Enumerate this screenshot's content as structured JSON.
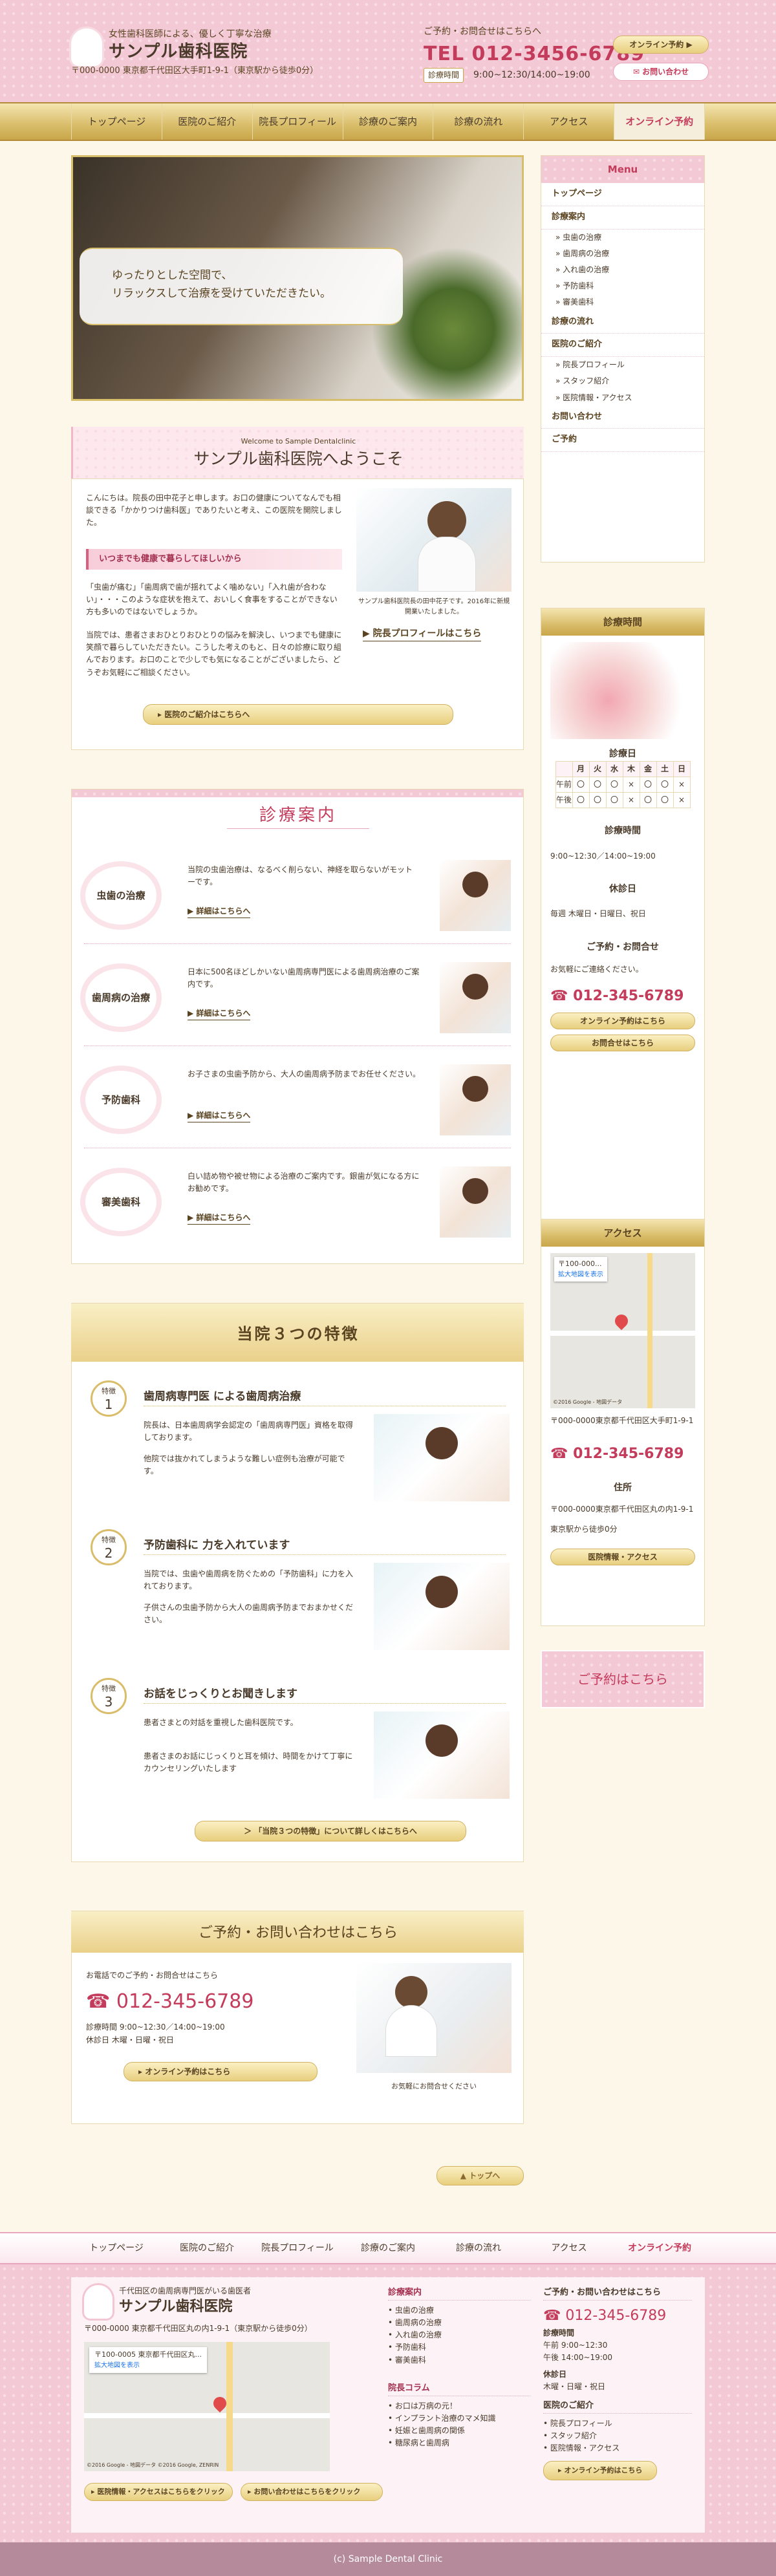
{
  "header": {
    "tagline": "女性歯科医師による、優しく丁寧な治療",
    "site_name": "サンプル歯科医院",
    "address": "〒000-0000 東京都千代田区大手町1-9-1（東京駅から徒歩0分）",
    "contact_label": "ご予約・お問合せはこちらへ",
    "tel": "TEL 012-3456-6789",
    "hours_label": "診療時間",
    "hours": "9:00~12:30/14:00~19:00",
    "btn_online": "オンライン予約 ▶",
    "btn_contact": "✉ お問い合わせ"
  },
  "nav": [
    "トップページ",
    "医院のご紹介",
    "院長プロフィール",
    "診療のご案内",
    "診療の流れ",
    "アクセス",
    "オンライン予約"
  ],
  "hero": {
    "line1": "ゆったりとした空間で、",
    "line2": "リラックスして治療を受けていただきたい。"
  },
  "welcome": {
    "sub": "Welcome to Sample Dentalclinic",
    "title": "サンプル歯科医院へようこそ",
    "p1": "こんにちは。院長の田中花子と申します。お口の健康についてなんでも相談できる「かかりつけ歯科医」でありたいと考え、この医院を開院しました。",
    "heading": "いつまでも健康で暮らしてほしいから",
    "p2": "「虫歯が痛む」「歯周病で歯が揺れてよく噛めない」「入れ歯が合わない」・・・このような症状を抱えて、おいしく食事をすることができない方も多いのではないでしょうか。",
    "p3": "当院では、患者さまおひとりおひとりの悩みを解決し、いつまでも健康に笑顔で暮らしていただきたい。こうした考えのもと、日々の診療に取り組んでおります。お口のことで少しでも気になることがございましたら、どうぞお気軽にご相談ください。",
    "caption": "サンプル歯科医院長の田中花子です。2016年に新規開業いたしました。",
    "profile_link": "院長プロフィールはこちら",
    "clinic_link": "医院のご紹介はこちらへ"
  },
  "services": {
    "title": "診療案内",
    "items": [
      {
        "name": "虫歯の治療",
        "desc": "当院の虫歯治療は、なるべく削らない、神経を取らないがモットーです。",
        "link": "詳細はこちらへ"
      },
      {
        "name": "歯周病の治療",
        "desc": "日本に500名ほどしかいない歯周病専門医による歯周病治療のご案内です。",
        "link": "詳細はこちらへ"
      },
      {
        "name": "予防歯科",
        "desc": "お子さまの虫歯予防から、大人の歯周病予防までお任せください。",
        "link": "詳細はこちらへ"
      },
      {
        "name": "審美歯科",
        "desc": "白い詰め物や被せ物による治療のご案内です。銀歯が気になる方にお勧めです。",
        "link": "詳細はこちらへ"
      }
    ]
  },
  "features": {
    "title": "当院３つの特徴",
    "badge": "特徴",
    "items": [
      {
        "num": "1",
        "heading": "歯周病専門医 による歯周病治療",
        "p1": "院長は、日本歯周病学会認定の「歯周病専門医」資格を取得しております。",
        "p2": "他院では抜かれてしまうような難しい症例も治療が可能です。"
      },
      {
        "num": "2",
        "heading": "予防歯科に 力を入れています",
        "p1": "当院では、虫歯や歯周病を防ぐための「予防歯科」に力を入れております。",
        "p2": "子供さんの虫歯予防から大人の歯周病予防までおまかせください。"
      },
      {
        "num": "3",
        "heading": "お話をじっくりとお聞きします",
        "p1": "患者さまとの対話を重視した歯科医院です。",
        "p2": "患者さまのお話にじっくりと耳を傾け、時間をかけて丁寧にカウンセリングいたします"
      }
    ],
    "link": "「当院３つの特徴」について詳しくはこちらへ"
  },
  "contact": {
    "title": "ご予約・お問い合わせはこちら",
    "intro": "お電話でのご予約・お問合せはこちら",
    "tel": "012-345-6789",
    "hours": "診療時間 9:00~12:30／14:00~19:00",
    "closed": "休診日 木曜・日曜・祝日",
    "btn": "オンライン予約はこちら",
    "caption": "お気軽にお問合せください"
  },
  "pagetop": "▲ トップへ",
  "sidebar": {
    "menu_title": "Menu",
    "menu": [
      {
        "t": "トップページ",
        "sub": []
      },
      {
        "t": "診療案内",
        "sub": [
          "虫歯の治療",
          "歯周病の治療",
          "入れ歯の治療",
          "予防歯科",
          "審美歯科"
        ]
      },
      {
        "t": "診療の流れ",
        "sub": []
      },
      {
        "t": "医院のご紹介",
        "sub": [
          "院長プロフィール",
          "スタッフ紹介",
          "医院情報・アクセス"
        ]
      },
      {
        "t": "お問い合わせ",
        "sub": []
      },
      {
        "t": "ご予約",
        "sub": []
      }
    ],
    "hours_title": "診療時間",
    "cal_title": "診療日",
    "cal_head": [
      "",
      "月",
      "火",
      "水",
      "木",
      "金",
      "土",
      "日"
    ],
    "cal_rows": [
      [
        "午前",
        "〇",
        "〇",
        "〇",
        "×",
        "〇",
        "〇",
        "×"
      ],
      [
        "午後",
        "〇",
        "〇",
        "〇",
        "×",
        "〇",
        "〇",
        "×"
      ]
    ],
    "hours_h": "診療時間",
    "hours_v": "9:00~12:30／14:00~19:00",
    "closed_h": "休診日",
    "closed_v": "毎週 木曜日・日曜日、祝日",
    "contact_h": "ご予約・お問合せ",
    "contact_p": "お気軽にご連絡ください。",
    "tel": "012-345-6789",
    "btn_online": "オンライン予約はこちら",
    "btn_contact": "お問合せはこちら",
    "access_title": "アクセス",
    "map_label": "〒100-000...",
    "map_link": "拡大地図を表示",
    "map_credit": "©2016 Google - 地図データ",
    "access_addr": "〒000-0000東京都千代田区大手町1-9-1",
    "access_tel": "012-345-6789",
    "addr_h": "住所",
    "addr_v": "〒000-0000東京都千代田区丸の内1-9-1",
    "walk": "東京駅から徒歩0分",
    "info_btn": "医院情報・アクセス",
    "reserve": "ご予約はこちら"
  },
  "footer": {
    "nav": [
      "トップページ",
      "医院のご紹介",
      "院長プロフィール",
      "診療のご案内",
      "診療の流れ",
      "アクセス",
      "オンライン予約"
    ],
    "tagline": "千代田区の歯周病専門医がいる歯医者",
    "site": "サンプル歯科医院",
    "address": "〒000-0000 東京都千代田区丸の内1-9-1（東京駅から徒歩0分）",
    "map_label": "〒100-0005 東京都千代田区丸...",
    "map_link": "拡大地図を表示",
    "map_credit": "©2016 Google - 地図データ ©2016 Google, ZENRIN",
    "btn_access": "医院情報・アクセスはこちらをクリック",
    "btn_contact": "お問い合わせはこちらをクリック",
    "col1_title": "診療案内",
    "col1": [
      "虫歯の治療",
      "歯周病の治療",
      "入れ歯の治療",
      "予防歯科",
      "審美歯科"
    ],
    "col2_title": "院長コラム",
    "col2": [
      "お口は万病の元！",
      "インプラント治療のマメ知識",
      "妊娠と歯周病の関係",
      "糖尿病と歯周病"
    ],
    "col3_title": "ご予約・お問い合わせはこちら",
    "tel": "012-345-6789",
    "hours_h": "診療時間",
    "am": "午前 9:00~12:30",
    "pm": "午後 14:00~19:00",
    "closed_h": "休診日",
    "closed": "木曜・日曜・祝日",
    "col4_title": "医院のご紹介",
    "col4": [
      "院長プロフィール",
      "スタッフ紹介",
      "医院情報・アクセス"
    ],
    "btn_online": "オンライン予約はこちら",
    "copyright": "(c)   Sample Dental Clinic"
  },
  "colors": {
    "pink": "#f4c9d6",
    "accent": "#c43c5c",
    "gold": "#d9bd6a"
  }
}
